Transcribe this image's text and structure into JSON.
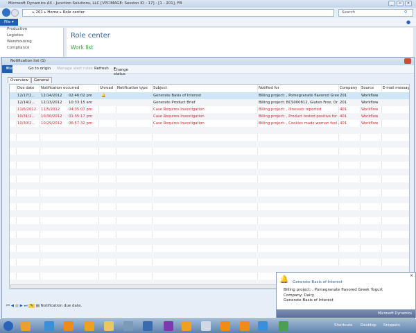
{
  "window": {
    "title": "Microsoft Dynamics AX - Junction Solutions, LLC [VPCIMAGE: Session ID - 17] - [1 - 201], FB"
  },
  "address": {
    "breadcrumb": [
      "201",
      "Home",
      "Role center"
    ],
    "search_placeholder": "Search"
  },
  "file_label": "File",
  "sidebar": {
    "items": [
      "Production",
      "Logistics",
      "Warehousing",
      "Compliance"
    ]
  },
  "role_center": {
    "title": "Role center",
    "section": "Work list"
  },
  "notification": {
    "title": "Notification list (1)",
    "ribbon": {
      "file": "File",
      "go_to_origin": "Go to origin",
      "manage_alert_rules": "Manage alert rules",
      "refresh": "Refresh",
      "change_status": "Change status"
    },
    "tabs": [
      "Overview",
      "General"
    ],
    "columns": [
      "Due date",
      "Notification occurred",
      "Unread",
      "Notification type",
      "Subject",
      "Notified for",
      "Company",
      "Source",
      "E-mail message"
    ],
    "rows": [
      {
        "due": "12/17/2...",
        "date": "12/14/2012",
        "time": "02:46:02 pm",
        "unread": true,
        "subject": "Generate Basis of Interest",
        "for": "Billing project: , Pomegranate flavored Gree...",
        "company": "201",
        "source": "Workflow",
        "email": false,
        "red": false,
        "selected": true
      },
      {
        "due": "12/14/2...",
        "date": "12/13/2012",
        "time": "10:33:15 am",
        "unread": false,
        "subject": "Generate Product Brief",
        "for": "Billing project: BCS000812, Gluten Free, Or...",
        "company": "201",
        "source": "Workflow",
        "email": false,
        "red": false
      },
      {
        "due": "11/6/2012",
        "date": "11/5/2012",
        "time": "04:35:07 pm",
        "unread": false,
        "subject": "Case Requires Investigation",
        "for": "Billing project: , Illnesses reported",
        "company": "401",
        "source": "Workflow",
        "email": true,
        "red": true
      },
      {
        "due": "10/31/2...",
        "date": "10/30/2012",
        "time": "01:35:17 pm",
        "unread": false,
        "subject": "Case Requires Investigation",
        "for": "Billing project: , Product tested positive for ...",
        "company": "401",
        "source": "Workflow",
        "email": true,
        "red": true
      },
      {
        "due": "10/30/2...",
        "date": "10/29/2012",
        "time": "06:57:32 pm",
        "unread": false,
        "subject": "Case Requires Investigation",
        "for": "Billing project: , Cookies made woman feel ...",
        "company": "401",
        "source": "Workflow",
        "email": true,
        "red": true
      }
    ],
    "status_text": "Notification due date."
  },
  "popup": {
    "title": "Generate Basis of Interest",
    "lines": [
      "Billing project: , Pomegranate flavored Greek Yogurt",
      "Company: Dairy",
      "Generate Basis of Interest"
    ],
    "brand": "Microsoft Dynamics"
  },
  "taskbar": {
    "items": [
      "Shortcuts",
      "Desktop",
      "Snippets"
    ]
  },
  "colors": {
    "accent": "#1e5fb4",
    "alert_red": "#c8282c",
    "selected_row": "#cfe6f7"
  }
}
